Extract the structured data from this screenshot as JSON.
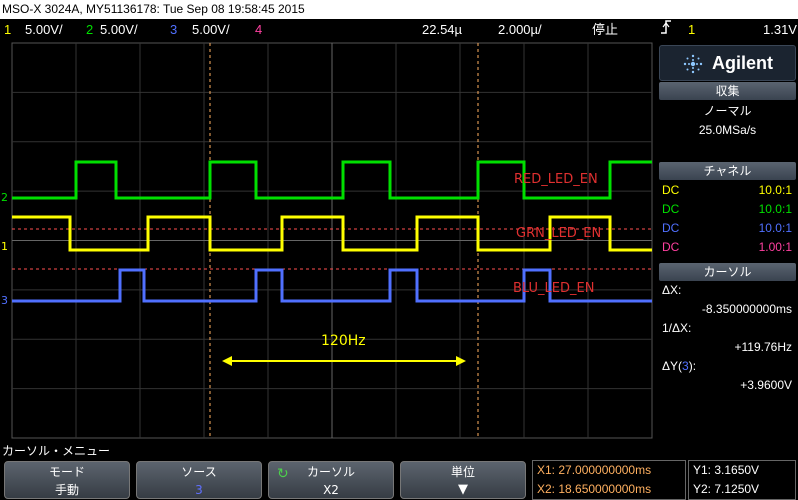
{
  "title": "MSO-X 3024A, MY51136178: Tue Sep 08 19:58:45 2015",
  "status": {
    "ch1": {
      "num": "1",
      "scale": "5.00V/"
    },
    "ch2": {
      "num": "2",
      "scale": "5.00V/"
    },
    "ch3": {
      "num": "3",
      "scale": "5.00V/"
    },
    "ch4": {
      "num": "4"
    },
    "time_offset": "22.54µ",
    "timebase": "2.000µ/",
    "run_state": "停止",
    "trigger_icon": "rising-edge-icon",
    "trigger_ch": "1",
    "trigger_level": "1.31V"
  },
  "colors": {
    "ch1": "#ffff00",
    "ch2": "#00e000",
    "ch3": "#5070ff",
    "ch4": "#ff40a0",
    "label_red": "#e03030",
    "cursor": "#ffb060"
  },
  "signal_labels": {
    "red": "RED_LED_EN",
    "green": "GRN_LED_EN",
    "blue": "BLU_LED_EN",
    "freq": "120Hz"
  },
  "panel": {
    "brand": "Agilent",
    "acq_head": "収集",
    "acq_mode": "ノーマル",
    "acq_rate": "25.0MSa/s",
    "ch_head": "チャネル",
    "channels": [
      {
        "coupling": "DC",
        "ratio": "10.0:1"
      },
      {
        "coupling": "DC",
        "ratio": "10.0:1"
      },
      {
        "coupling": "DC",
        "ratio": "10.0:1"
      },
      {
        "coupling": "DC",
        "ratio": "1.00:1"
      }
    ],
    "cursor_head": "カーソル",
    "dx_label": "ΔX:",
    "dx_value": "-8.350000000ms",
    "inv_dx_label": "1/ΔX:",
    "inv_dx_value": "+119.76Hz",
    "dy_label_prefix": "ΔY(",
    "dy_ch": "3",
    "dy_label_suffix": "):",
    "dy_value": "+3.9600V"
  },
  "menu": {
    "title": "カーソル・メニュー",
    "mode_label": "モード",
    "mode_value": "手動",
    "source_label": "ソース",
    "source_value": "3",
    "cursor_label": "カーソル",
    "cursor_value": "X2",
    "unit_label": "単位",
    "x1": "X1: 27.000000000ms",
    "x2": "X2: 18.650000000ms",
    "y1": "Y1: 3.1650V",
    "y2": "Y2: 7.1250V"
  }
}
